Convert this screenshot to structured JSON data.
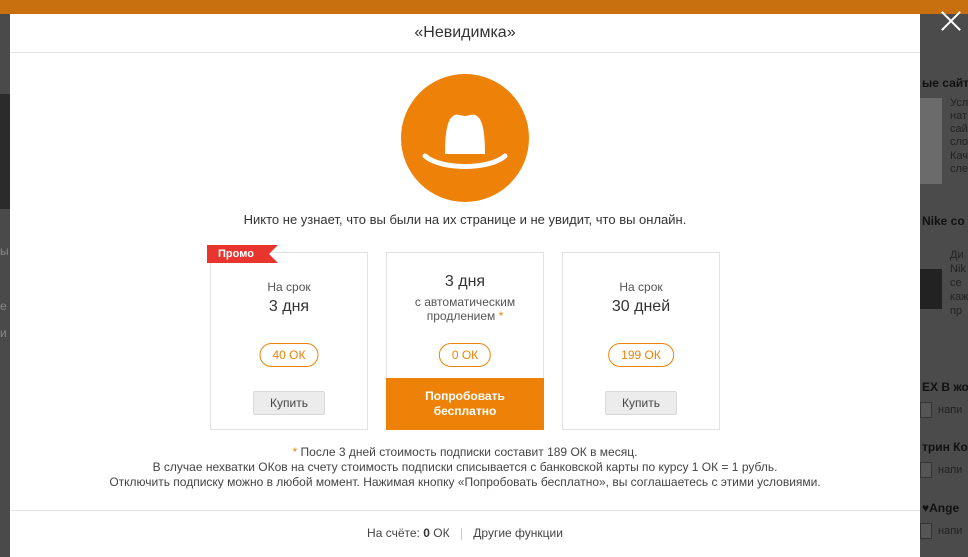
{
  "modal": {
    "title": "«Невидимка»",
    "close_icon": "close-icon",
    "hat_icon": "hat-icon",
    "description": "Никто не узнает, что вы были на их странице и не увидит, что вы онлайн.",
    "accent_color": "#ee8208",
    "promo_color": "#e8362f"
  },
  "plans": [
    {
      "badge": "Промо",
      "term_label": "На срок",
      "term": "3 дня",
      "price": "40 ОК",
      "button": "Купить"
    },
    {
      "term": "3 дня",
      "sub_line1": "с автоматическим",
      "sub_line2": "продлением",
      "star": "*",
      "price": "0 ОК",
      "button_line1": "Попробовать",
      "button_line2": "бесплатно"
    },
    {
      "term_label": "На срок",
      "term": "30 дней",
      "price": "199 ОК",
      "button": "Купить"
    }
  ],
  "notes": {
    "star": "*",
    "line1": " После 3 дней стоимость подписки составит 189 ОК в месяц.",
    "line2": "В случае нехватки ОКов на счету стоимость подписки списывается с банковской карты по курсу 1 ОК = 1 рубль.",
    "line3": "Отключить подписку можно в любой момент. Нажимая кнопку «Попробовать бесплатно», вы соглашаетесь с этими условиями."
  },
  "footer": {
    "balance_label": "На счёте:",
    "balance_value": "0",
    "balance_unit": "ОК",
    "other_functions": "Другие функции"
  },
  "background": {
    "right_texts": [
      "ые сайт",
      "Nike co",
      "EX В жо",
      "трин Ков",
      "♥Ange"
    ],
    "right_small1": [
      "Усл",
      "нат",
      "сай",
      "сло",
      "Кач",
      "сле"
    ],
    "right_small2": [
      "Ди",
      "Nik",
      "се",
      "каж",
      "пр"
    ],
    "right_field_text": [
      "напи",
      "напи",
      "напи"
    ]
  }
}
